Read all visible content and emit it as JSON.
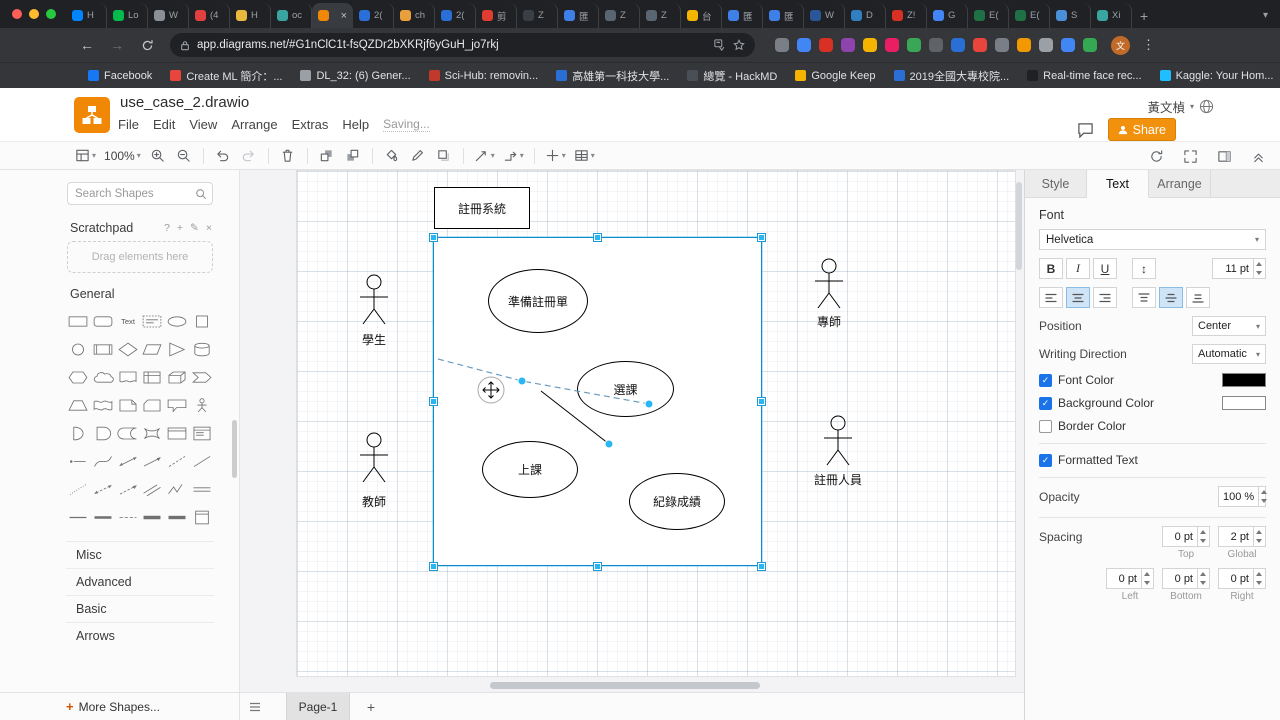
{
  "glyphs": {
    "close": "×",
    "plus": "+",
    "kebab": "⋮",
    "overflow": "»",
    "caret": "▾",
    "back": "←",
    "forward": "→",
    "updown": "↕"
  },
  "browser": {
    "tabs": [
      {
        "label": "H",
        "color": "#0084ff"
      },
      {
        "label": "Lo",
        "color": "#04ba4c"
      },
      {
        "label": "W",
        "color": "#8a8f98"
      },
      {
        "label": "(4",
        "color": "#e04040"
      },
      {
        "label": "H",
        "color": "#e8b93c"
      },
      {
        "label": "oc",
        "color": "#3aa5a0"
      },
      {
        "label": "",
        "color": "#f08705",
        "active": true
      },
      {
        "label": "2(",
        "color": "#2a6fd6"
      },
      {
        "label": "ch",
        "color": "#e9a03c"
      },
      {
        "label": "2(",
        "color": "#2a6fd6"
      },
      {
        "label": "剪",
        "color": "#e03c31"
      },
      {
        "label": "Z",
        "color": "#3a3f46"
      },
      {
        "label": "匯",
        "color": "#3f7fe8"
      },
      {
        "label": "Z",
        "color": "#5a6572"
      },
      {
        "label": "Z",
        "color": "#5a6572"
      },
      {
        "label": "台",
        "color": "#f4b400"
      },
      {
        "label": "匯",
        "color": "#3f7fe8"
      },
      {
        "label": "匯",
        "color": "#3f7fe8"
      },
      {
        "label": "W",
        "color": "#2b579a"
      },
      {
        "label": "D",
        "color": "#2f7fc1"
      },
      {
        "label": "Z!",
        "color": "#d93025"
      },
      {
        "label": "G",
        "color": "#4285f4"
      },
      {
        "label": "E(",
        "color": "#1e7145"
      },
      {
        "label": "E(",
        "color": "#1e7145"
      },
      {
        "label": "S",
        "color": "#4a90d9"
      },
      {
        "label": "Xi",
        "color": "#3aa5a0"
      }
    ],
    "url": "app.diagrams.net/#G1nClC1t-fsQZDr2bXKRjf6yGuH_jo7rkj",
    "extensions": [
      "#7a7f87",
      "#4285f4",
      "#d93025",
      "#8e44ad",
      "#f4b400",
      "#e91e63",
      "#3aa757",
      "#5f6368",
      "#2a6fd6",
      "#e8453c",
      "#7a7f87",
      "#f29900",
      "#9aa0a6",
      "#4285f4",
      "#34a853"
    ],
    "profile_initial": "文",
    "bookmarks": [
      {
        "label": "Facebook",
        "color": "#1877f2"
      },
      {
        "label": "Create ML 簡介：...",
        "color": "#e8453c"
      },
      {
        "label": "DL_32: (6) Gener...",
        "color": "#9aa0a6"
      },
      {
        "label": "Sci-Hub: removin...",
        "color": "#c0392b"
      },
      {
        "label": "高雄第一科技大學...",
        "color": "#2a6fd6"
      },
      {
        "label": "總覽 - HackMD",
        "color": "#4a4f57"
      },
      {
        "label": "Google Keep",
        "color": "#f5b400"
      },
      {
        "label": "2019全國大專校院...",
        "color": "#2a6fd6"
      },
      {
        "label": "Real-time face rec...",
        "color": "#202124"
      },
      {
        "label": "Kaggle: Your Hom...",
        "color": "#20beff"
      }
    ]
  },
  "app": {
    "title": "use_case_2.drawio",
    "menus": [
      "File",
      "Edit",
      "View",
      "Arrange",
      "Extras",
      "Help"
    ],
    "saving": "Saving...",
    "user_name": "黃文楨",
    "share_label": "Share"
  },
  "toolbar": {
    "zoom_level": "100%"
  },
  "sidebar": {
    "search_placeholder": "Search Shapes",
    "scratchpad_title": "Scratchpad",
    "scratchpad_actions": [
      "?",
      "+",
      "✎",
      "×"
    ],
    "drag_hint": "Drag elements here",
    "general_title": "General",
    "shapes": [
      "rectangle",
      "rounded-rectangle",
      "text",
      "textbox",
      "ellipse",
      "square",
      "circle",
      "process",
      "diamond",
      "parallelogram",
      "triangle",
      "cylinder",
      "hexagon",
      "cloud",
      "document",
      "internal-storage",
      "cube",
      "step",
      "trapezoid",
      "tape",
      "note",
      "card",
      "callout",
      "actor",
      "or",
      "and",
      "data-storage",
      "switch",
      "container",
      "list",
      "list-item",
      "curve",
      "bidirectional-arrow",
      "arrow",
      "dashed-line",
      "line",
      "dotted-line",
      "bidirectional-connector",
      "directional-connector",
      "link",
      "zigzag",
      "double-line",
      "horizontal-line",
      "horizontal-rule",
      "divider",
      "bold-line",
      "filled-line",
      "vertical-container"
    ],
    "sections": [
      "Misc",
      "Advanced",
      "Basic",
      "Arrows"
    ],
    "more_shapes_label": "More Shapes..."
  },
  "canvas": {
    "system_title": "註冊系統",
    "use_cases": [
      "準備註冊單",
      "選課",
      "上課",
      "紀錄成績"
    ],
    "actors": [
      "學生",
      "教師",
      "專師",
      "註冊人員"
    ]
  },
  "format_panel": {
    "tabs": [
      "Style",
      "Text",
      "Arrange"
    ],
    "font_section_label": "Font",
    "font_name": "Helvetica",
    "bold_label": "B",
    "italic_label": "I",
    "underline_label": "U",
    "font_size": "11 pt",
    "position_label": "Position",
    "position_value": "Center",
    "writing_direction_label": "Writing Direction",
    "writing_direction_value": "Automatic",
    "font_color_label": "Font Color",
    "background_color_label": "Background Color",
    "border_color_label": "Border Color",
    "formatted_text_label": "Formatted Text",
    "font_color_value": "#000000",
    "background_color_value": "#ffffff",
    "opacity_label": "Opacity",
    "opacity_value": "100 %",
    "spacing_label": "Spacing",
    "spacing": {
      "top": "0 pt",
      "global": "2 pt",
      "left": "0 pt",
      "bottom": "0 pt",
      "right": "0 pt"
    },
    "spacing_labels": {
      "top": "Top",
      "global": "Global",
      "left": "Left",
      "bottom": "Bottom",
      "right": "Right"
    }
  },
  "footer": {
    "page_tab": "Page-1",
    "add_page": "+"
  }
}
